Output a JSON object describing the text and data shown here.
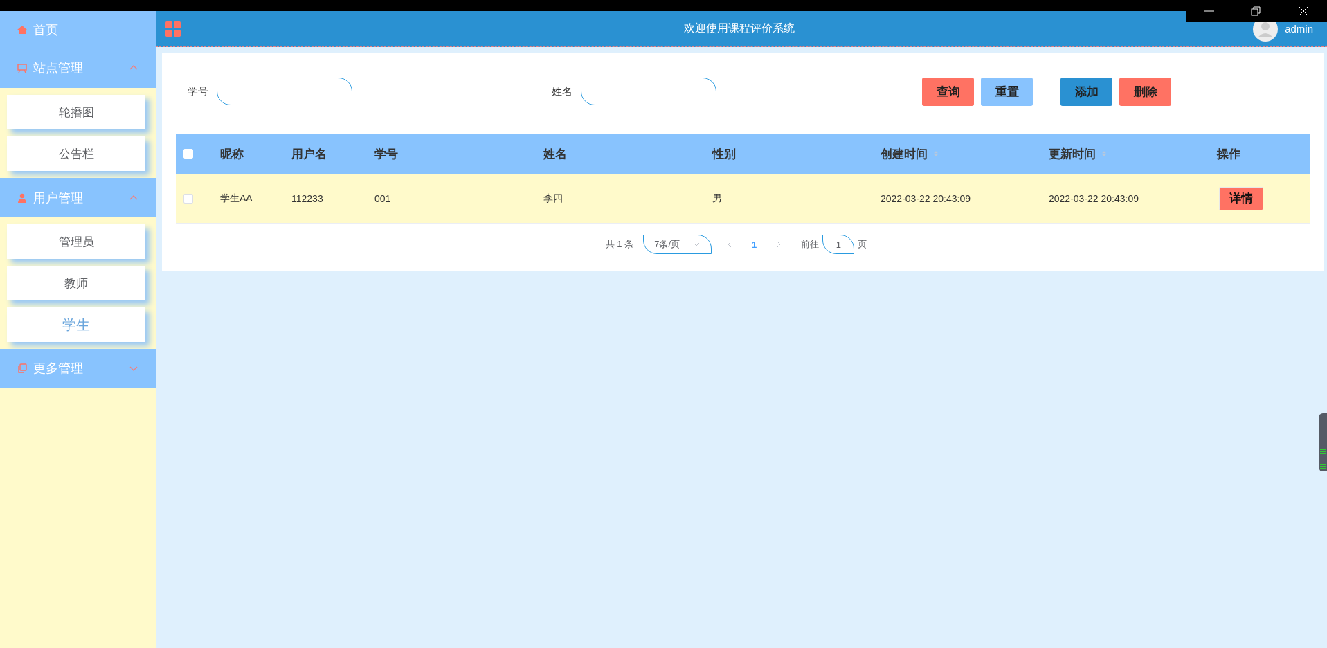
{
  "sidebar": {
    "items": [
      {
        "label": "首页",
        "kind": "link"
      },
      {
        "label": "站点管理",
        "kind": "group",
        "expanded": true,
        "children": [
          {
            "label": "轮播图",
            "selected": false
          },
          {
            "label": "公告栏",
            "selected": false
          }
        ]
      },
      {
        "label": "用户管理",
        "kind": "group",
        "expanded": true,
        "children": [
          {
            "label": "管理员",
            "selected": false
          },
          {
            "label": "教师",
            "selected": false
          },
          {
            "label": "学生",
            "selected": true
          }
        ]
      },
      {
        "label": "更多管理",
        "kind": "group",
        "expanded": false
      }
    ]
  },
  "header": {
    "title": "欢迎使用课程评价系统",
    "user": "admin"
  },
  "search": {
    "fields": [
      {
        "label": "学号"
      },
      {
        "label": "姓名"
      }
    ],
    "buttons": [
      {
        "label": "查询",
        "color": "#ff7263"
      },
      {
        "label": "重置",
        "color": "#88c3fe"
      },
      {
        "label": "添加",
        "color": "#2a91d2"
      },
      {
        "label": "删除",
        "color": "#ff7263"
      }
    ]
  },
  "table": {
    "select_all": {
      "checked": false
    },
    "columns": [
      {
        "label": "昵称",
        "sortable": false
      },
      {
        "label": "用户名",
        "sortable": false
      },
      {
        "label": "学号",
        "sortable": false
      },
      {
        "label": "姓名",
        "sortable": false
      },
      {
        "label": "性别",
        "sortable": false
      },
      {
        "label": "创建时间",
        "sortable": true
      },
      {
        "label": "更新时间",
        "sortable": true
      },
      {
        "label": "操作",
        "sortable": false
      }
    ],
    "rows": [
      {
        "checked": false,
        "cells": [
          "学生AA",
          "112233",
          "001",
          "李四",
          "男",
          "2022-03-22 20:43:09",
          "2022-03-22 20:43:09"
        ],
        "action": "详情"
      }
    ]
  },
  "pagination": {
    "total": "共 1 条",
    "page_size": "7条/页",
    "pages": [
      {
        "label": "1",
        "selected": true
      }
    ],
    "goto_label": "前往",
    "goto_value": "1",
    "goto_suffix": "页"
  }
}
